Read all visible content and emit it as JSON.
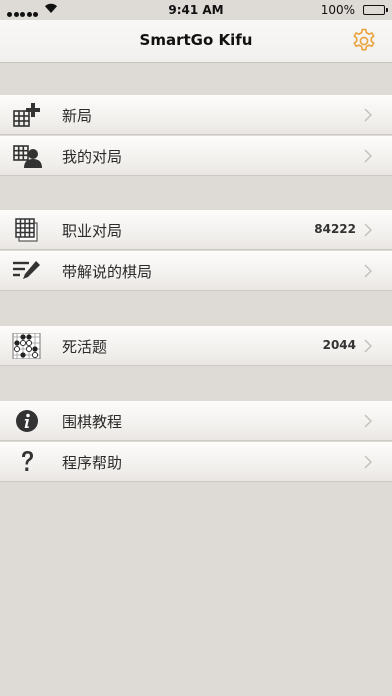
{
  "status_bar": {
    "time": "9:41 AM",
    "battery": "100%"
  },
  "nav": {
    "title": "SmartGo Kifu",
    "settings_icon": "gear-icon",
    "accent_color": "#e8a33c"
  },
  "menu": {
    "new_game": {
      "label": "新局",
      "icon": "new-board-icon"
    },
    "my_games": {
      "label": "我的对局",
      "icon": "board-person-icon"
    },
    "pro_games": {
      "label": "职业对局",
      "count": "84222",
      "icon": "grid-stack-icon"
    },
    "commented_games": {
      "label": "带解说的棋局",
      "icon": "edit-list-icon"
    },
    "problems": {
      "label": "死活题",
      "count": "2044",
      "icon": "go-problem-icon"
    },
    "tutorial": {
      "label": "围棋教程",
      "icon": "info-icon"
    },
    "help": {
      "label": "程序帮助",
      "icon": "question-icon"
    }
  }
}
